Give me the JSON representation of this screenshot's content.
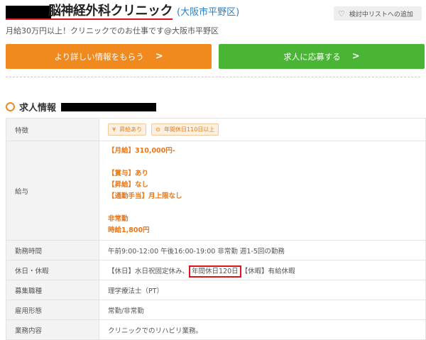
{
  "header": {
    "clinic_name": "脳神経外科クリニック",
    "location": "(大阪市平野区)",
    "favorite_label": "検討中リストへの追加",
    "subtitle": "月給30万円以上！クリニックでのお仕事です@大阪市平野区"
  },
  "actions": {
    "info_label": "より詳しい情報をもらう",
    "apply_label": "求人に応募する"
  },
  "section": {
    "title": "求人情報"
  },
  "colors": {
    "orange": "#f08a1f",
    "green": "#4ab535",
    "red": "#e0141e",
    "link_blue": "#2b7fc3"
  },
  "table": {
    "features_label": "特徴",
    "features": [
      "昇給あり",
      "年間休日110日以上"
    ],
    "salary_label": "給与",
    "salary_lines": {
      "monthly": "【月給】310,000円-",
      "bonus": "【賞与】あり",
      "raise": "【昇給】なし",
      "commute": "【通勤手当】月上限なし",
      "part": "非常勤",
      "hourly": "時給1,800円"
    },
    "hours_label": "勤務時間",
    "hours": "午前9:00-12:00 午後16:00-19:00 非常勤 週1-5回の勤務",
    "holiday_label": "休日・休暇",
    "holiday_pre": "【休日】水日祝固定休み、",
    "holiday_hl": "年間休日120日",
    "holiday_post": "【休暇】有給休暇",
    "job_type_label": "募集職種",
    "job_type": "理学療法士（PT）",
    "employment_label": "雇用形態",
    "employment": "常勤/非常勤",
    "duties_label": "業務内容",
    "duties": "クリニックでのリハビリ業務。"
  }
}
